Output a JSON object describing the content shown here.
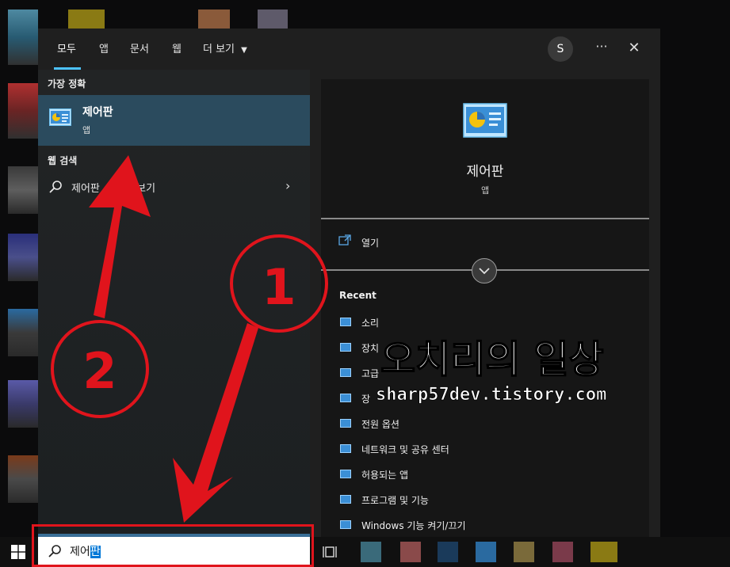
{
  "tabs": [
    {
      "label": "모두"
    },
    {
      "label": "앱"
    },
    {
      "label": "문서"
    },
    {
      "label": "웹"
    },
    {
      "label": "더 보기"
    }
  ],
  "account_initial": "S",
  "more_label": "···",
  "close_label": "✕",
  "best_match": {
    "section_label": "가장 정확",
    "title": "제어판",
    "subtitle": "앱"
  },
  "web_search": {
    "section_label": "웹 검색",
    "query_label": "제어판",
    "suffix": "과 보기"
  },
  "preview": {
    "title": "제어판",
    "subtitle": "앱",
    "open_label": "열기",
    "recent_label": "Recent",
    "recent_items": [
      "소리",
      "장치",
      "고급",
      "장",
      "전원 옵션",
      "네트워크 및 공유 센터",
      "허용되는 앱",
      "프로그램 및 기능",
      "Windows 기능 켜기/끄기"
    ]
  },
  "search": {
    "typed": "제어",
    "selected": "판"
  },
  "annotations": {
    "marker_1": "1",
    "marker_2": "2",
    "watermark_title": "오치리의 일상",
    "watermark_url": "sharp57dev.tistory.com"
  },
  "colors": {
    "highlight_row": "#2b4b5e",
    "accent": "#4cc2ff",
    "annotation_red": "#e0141c"
  }
}
